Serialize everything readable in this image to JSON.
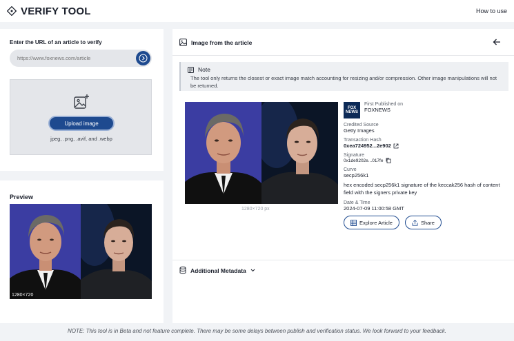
{
  "app": {
    "title": "VERIFY TOOL",
    "how_to": "How to use"
  },
  "left": {
    "url_label": "Enter the URL of an article to verify",
    "url_placeholder": "https://www.foxnews.com/article",
    "upload_button": "Upload image",
    "upload_types": "jpeg, .png, .avif, and .webp",
    "preview_label": "Preview",
    "preview_dimensions": "1280×720"
  },
  "right": {
    "section_title": "Image from the article",
    "note_title": "Note",
    "note_text": "The tool only returns the closest or exact image match accounting for resizing and/or compression. Other image manipulations will not be returned.",
    "image_dimensions": "1280×720 px",
    "first_published_label": "First Published on",
    "first_published_value": "FOXNEWS",
    "credited_source_label": "Credited Source",
    "credited_source_value": "Getty Images",
    "transaction_label": "Transaction Hash",
    "transaction_value": "0xea724952...2e902",
    "signature_label": "Signature",
    "signature_value": "0x1de9202e...017fe",
    "curve_label": "Curve",
    "curve_value": "secp256k1",
    "curve_desc": "hex encoded secp256k1 signature of the keccak256 hash of content field with the signers private key",
    "datetime_label": "Date & Time",
    "datetime_value": "2024-07-09 11:00:58 GMT",
    "explore_button": "Explore Article",
    "share_button": "Share",
    "additional_metadata": "Additional Metadata"
  },
  "footer": "NOTE: This tool is in Beta and not feature complete. There may be some delays between publish and verification status. We look forward to your feedback.",
  "colors": {
    "primary": "#1e4a8f",
    "panel": "#ffffff",
    "background": "#f1f3f6"
  }
}
